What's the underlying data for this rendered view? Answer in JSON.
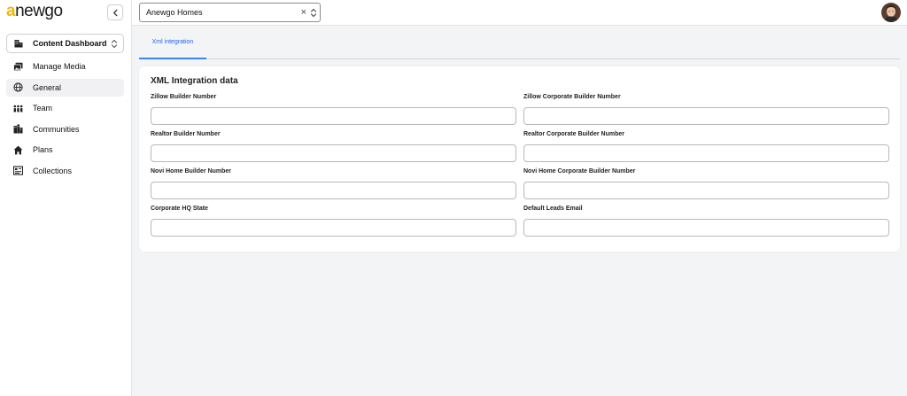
{
  "app": {
    "logo_first": "a",
    "logo_rest": "newgo"
  },
  "sidebar": {
    "dashboard_select": {
      "label": "Content Dashboard"
    },
    "items": [
      {
        "label": "Manage Media",
        "icon": "media-icon",
        "active": false
      },
      {
        "label": "General",
        "icon": "globe-icon",
        "active": true
      },
      {
        "label": "Team",
        "icon": "team-icon",
        "active": false
      },
      {
        "label": "Communities",
        "icon": "communities-icon",
        "active": false
      },
      {
        "label": "Plans",
        "icon": "home-icon",
        "active": false
      },
      {
        "label": "Collections",
        "icon": "collections-icon",
        "active": false
      }
    ]
  },
  "topbar": {
    "builder_select": {
      "value": "Anewgo Homes",
      "clear": "×"
    }
  },
  "tabs": [
    {
      "label": "Xml integration",
      "active": true
    }
  ],
  "card": {
    "title": "XML Integration data",
    "fields": [
      {
        "label": "Zillow Builder Number",
        "value": ""
      },
      {
        "label": "Zillow Corporate Builder Number",
        "value": ""
      },
      {
        "label": "Realtor Builder Number",
        "value": ""
      },
      {
        "label": "Realtor Corporate Builder Number",
        "value": ""
      },
      {
        "label": "Novi Home Builder Number",
        "value": ""
      },
      {
        "label": "Novi Home Corporate Builder Number",
        "value": ""
      },
      {
        "label": "Corporate HQ State",
        "value": ""
      },
      {
        "label": "Default Leads Email",
        "value": ""
      }
    ]
  },
  "colors": {
    "accent": "#3b82f6",
    "logo_accent": "#f2b705",
    "background": "#f3f4f6"
  }
}
